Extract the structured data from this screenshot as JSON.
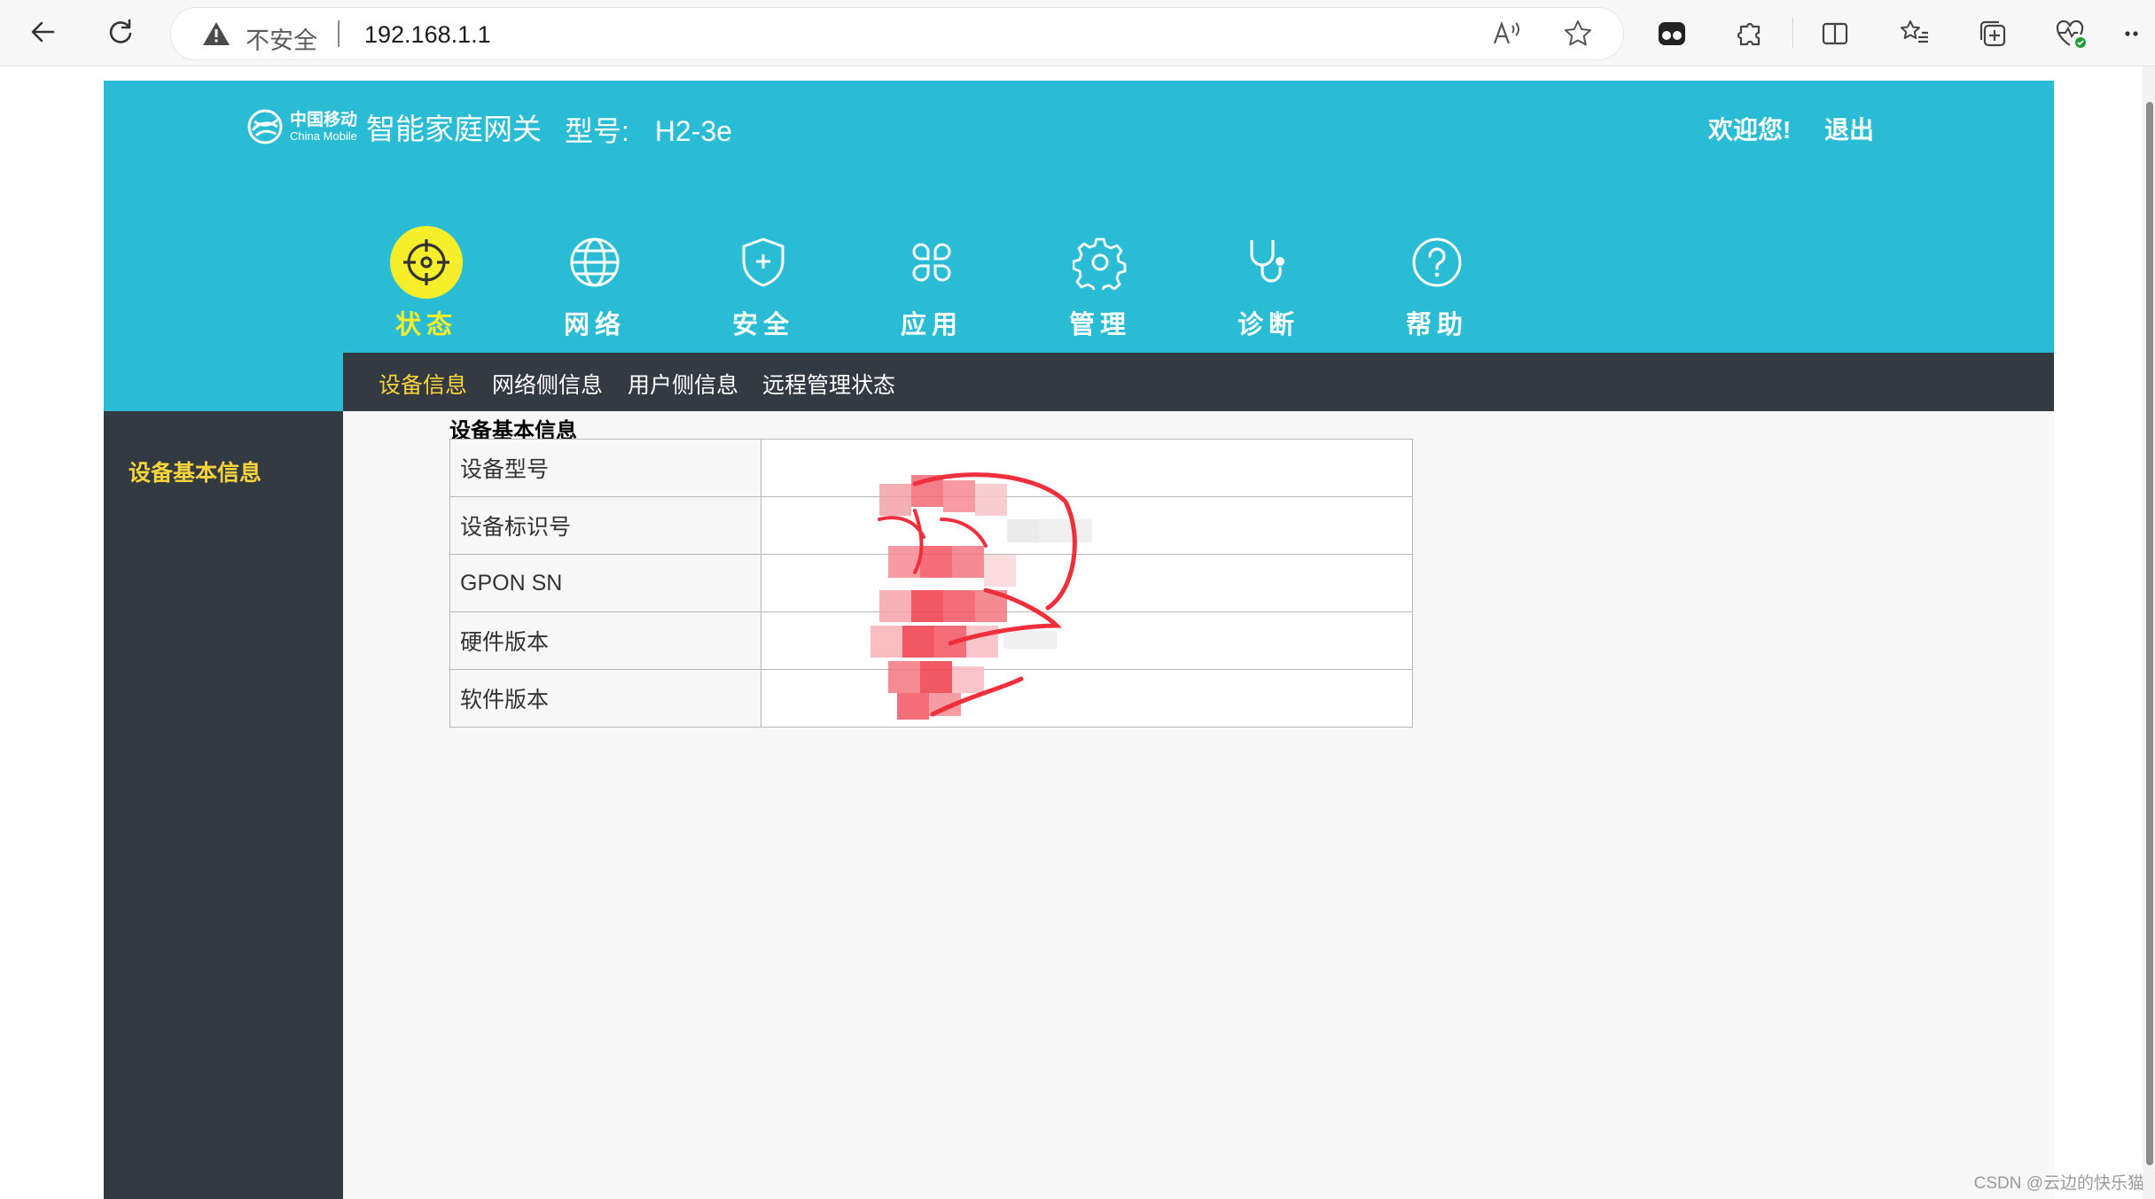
{
  "browser": {
    "security_label": "不安全",
    "url": "192.168.1.1"
  },
  "header": {
    "brand_cn": "中国移动",
    "brand_en": "China Mobile",
    "brand_name": "智能家庭网关",
    "model_label": "型号:",
    "model_value": "H2-3e",
    "welcome": "欢迎您!",
    "logout": "退出"
  },
  "menu": [
    {
      "label": "状态",
      "icon": "target-icon",
      "active": true
    },
    {
      "label": "网络",
      "icon": "globe-icon",
      "active": false
    },
    {
      "label": "安全",
      "icon": "shield-icon",
      "active": false
    },
    {
      "label": "应用",
      "icon": "apps-icon",
      "active": false
    },
    {
      "label": "管理",
      "icon": "gear-icon",
      "active": false
    },
    {
      "label": "诊断",
      "icon": "stethoscope-icon",
      "active": false
    },
    {
      "label": "帮助",
      "icon": "help-icon",
      "active": false
    }
  ],
  "subnav": [
    {
      "label": "设备信息",
      "active": true
    },
    {
      "label": "网络侧信息",
      "active": false
    },
    {
      "label": "用户侧信息",
      "active": false
    },
    {
      "label": "远程管理状态",
      "active": false
    }
  ],
  "sidebar": {
    "item": "设备基本信息"
  },
  "section": {
    "title": "设备基本信息",
    "rows": [
      {
        "label": "设备型号",
        "value": ""
      },
      {
        "label": "设备标识号",
        "value": ""
      },
      {
        "label": "GPON SN",
        "value": ""
      },
      {
        "label": "硬件版本",
        "value": ""
      },
      {
        "label": "软件版本",
        "value": ""
      }
    ]
  },
  "colors": {
    "header_bg": "#2bbcd5",
    "dark_nav": "#343a42",
    "active_yellow": "#f7ee2b",
    "active_text": "#f7d43a"
  },
  "watermark": "CSDN @云边的快乐猫"
}
